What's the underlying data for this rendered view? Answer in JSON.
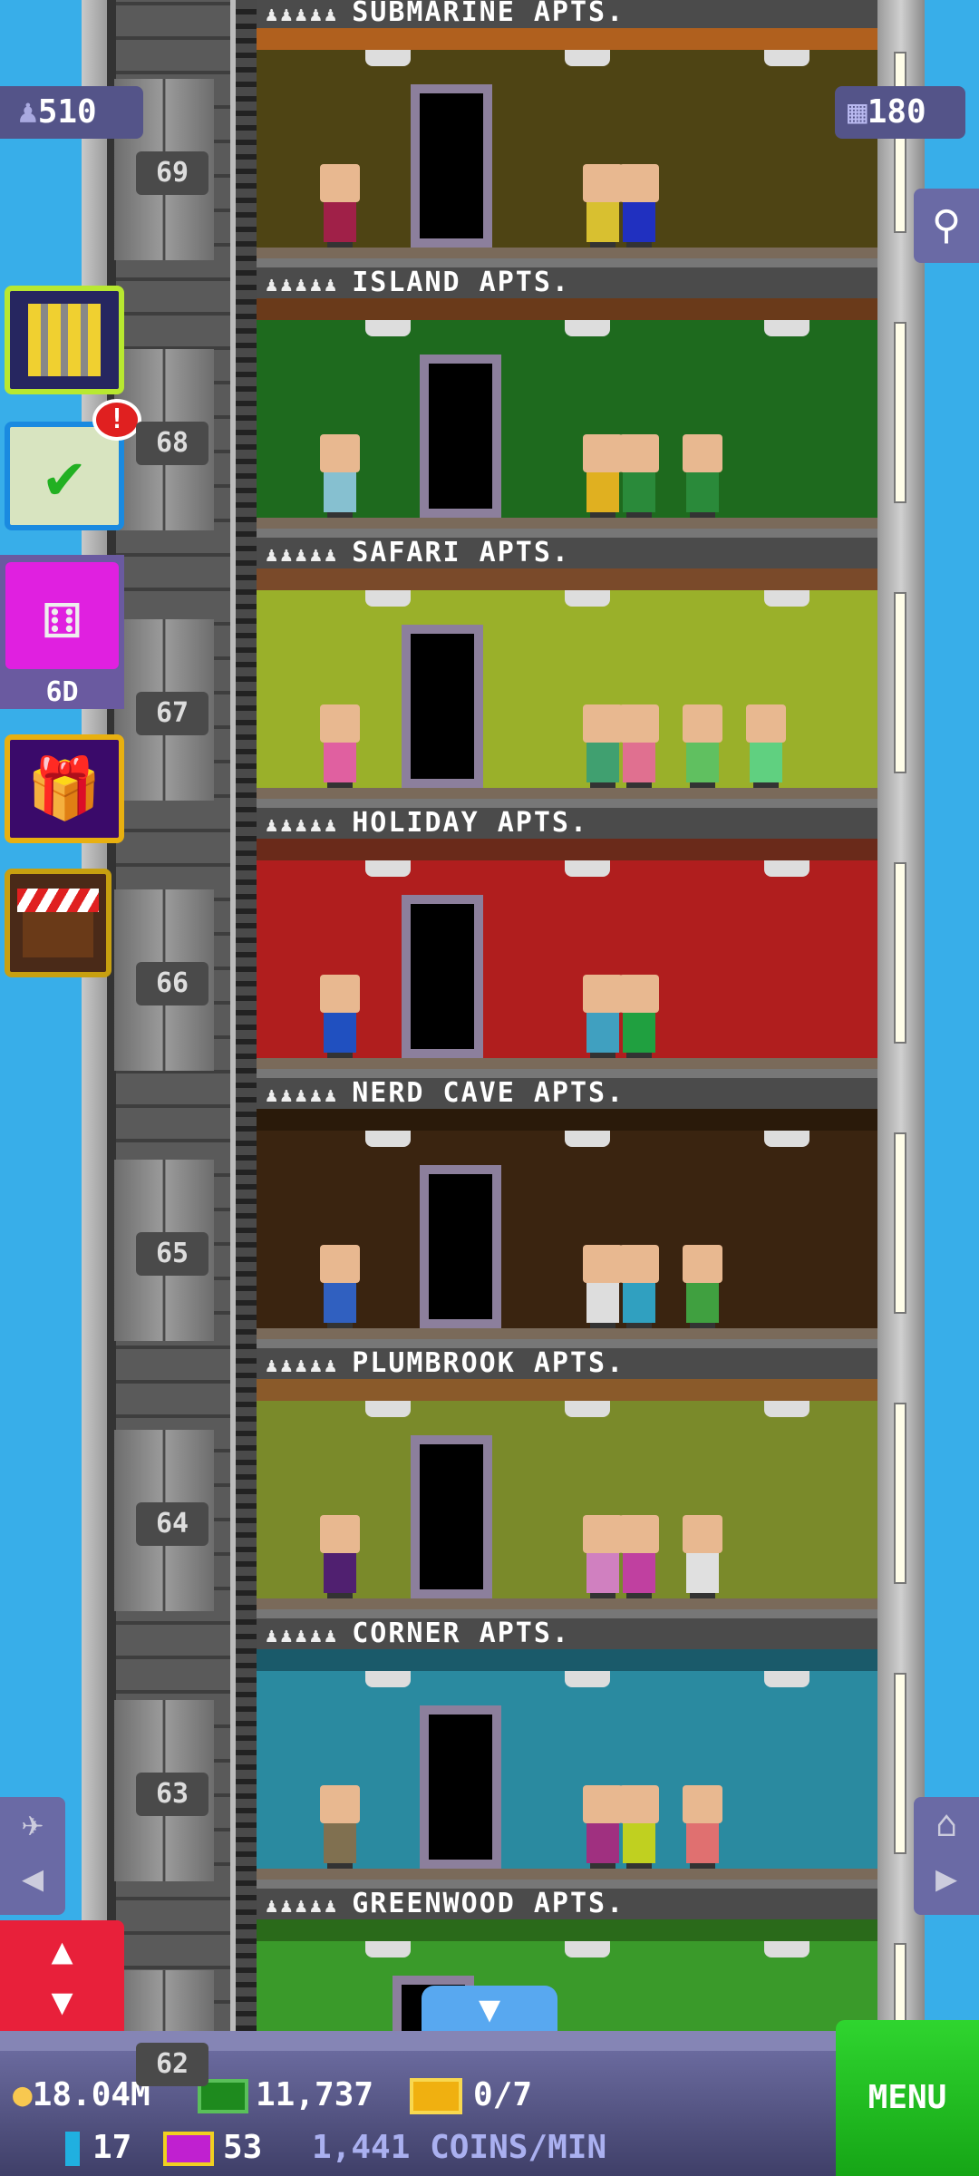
{
  "top": {
    "population": "510",
    "floors_count": "180"
  },
  "floors": [
    {
      "number": "69",
      "name": "SUBMARINE APTS.",
      "wall": "#4e4414",
      "ceiling": "#b0601e",
      "people": [
        "#a02048",
        "#d8c030",
        "#2030c0"
      ]
    },
    {
      "number": "68",
      "name": "ISLAND APTS.",
      "wall": "#1e6a1e",
      "ceiling": "#6a3a1a",
      "people": [
        "#86c0d0",
        "#e0b020",
        "#2a8a3a",
        "#2a8a3a"
      ]
    },
    {
      "number": "67",
      "name": "SAFARI APTS.",
      "wall": "#9ab02a",
      "ceiling": "#7a4a2a",
      "people": [
        "#e060a0",
        "#40a070",
        "#e07090",
        "#60c060",
        "#60d080"
      ]
    },
    {
      "number": "66",
      "name": "HOLIDAY APTS.",
      "wall": "#b01e1e",
      "ceiling": "#6a2a1a",
      "people": [
        "#2050c0",
        "#40a0c0",
        "#20a040"
      ]
    },
    {
      "number": "65",
      "name": "NERD CAVE APTS.",
      "wall": "#3a2410",
      "ceiling": "#2a1a0a",
      "people": [
        "#3060c0",
        "#dddddd",
        "#30a0c0",
        "#40a040"
      ]
    },
    {
      "number": "64",
      "name": "PLUMBROOK APTS.",
      "wall": "#7a8a2a",
      "ceiling": "#8a5a2a",
      "people": [
        "#502070",
        "#d080c0",
        "#c040a0",
        "#e0e0e0"
      ]
    },
    {
      "number": "63",
      "name": "CORNER APTS.",
      "wall": "#2a8aa0",
      "ceiling": "#1a5a6a",
      "people": [
        "#807050",
        "#a03080",
        "#c0d020",
        "#e07070"
      ]
    },
    {
      "number": "62",
      "name": "GREENWOOD APTS.",
      "wall": "#3a9a2a",
      "ceiling": "#2a6a1a",
      "people": []
    }
  ],
  "side_buttons": {
    "dice_timer": "6D",
    "task_alert": "!"
  },
  "bottom": {
    "coins": "18.04M",
    "bux": "11,737",
    "golden_tickets": "0/7",
    "energy": "17",
    "vip_tickets": "53",
    "rate": "1,441",
    "rate_unit": "COINS/MIN",
    "menu_label": "MENU"
  },
  "colors": {
    "sky": "#38aee9",
    "menu": "#22c022",
    "bar": "#50507f"
  }
}
